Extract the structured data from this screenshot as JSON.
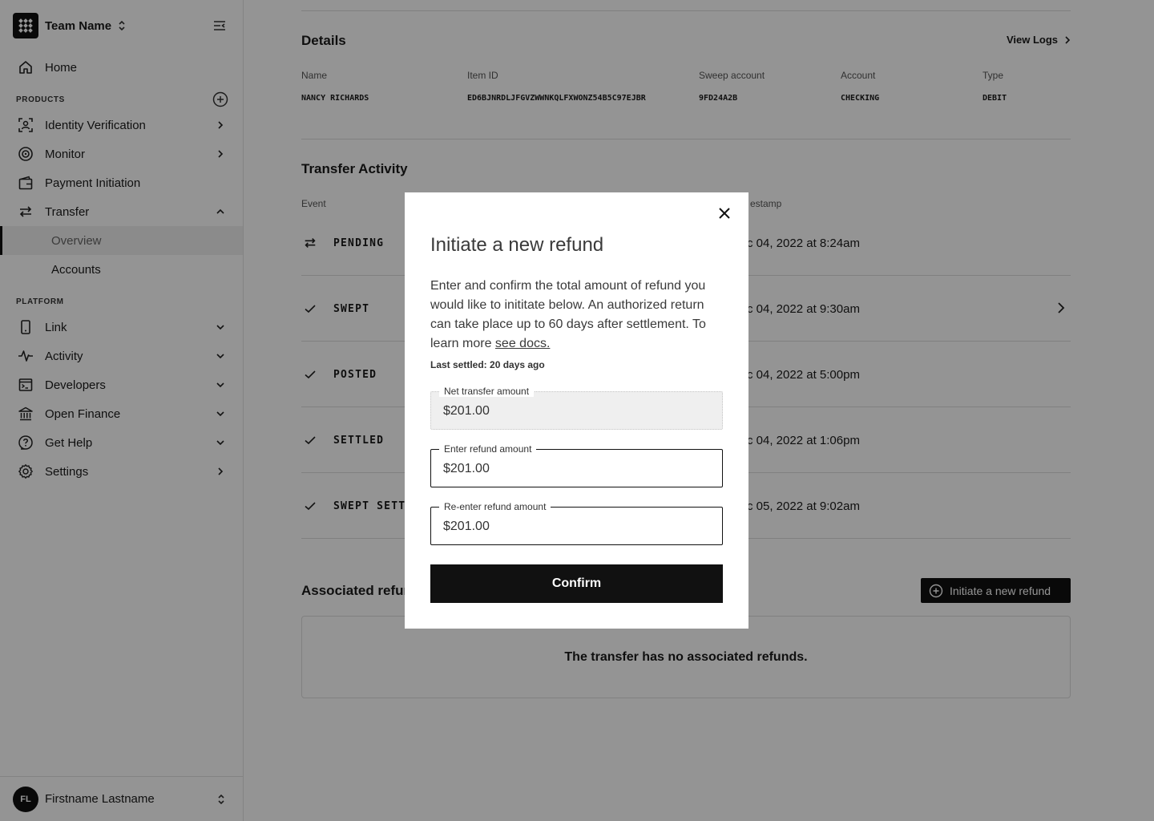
{
  "sidebar": {
    "team_name": "Team Name",
    "products_label": "PRODUCTS",
    "platform_label": "PLATFORM",
    "home": "Home",
    "products": [
      {
        "label": "Identity Verification"
      },
      {
        "label": "Monitor"
      },
      {
        "label": "Payment Initiation"
      },
      {
        "label": "Transfer"
      }
    ],
    "transfer_sub": [
      {
        "label": "Overview"
      },
      {
        "label": "Accounts"
      }
    ],
    "platform": [
      {
        "label": "Link"
      },
      {
        "label": "Activity"
      },
      {
        "label": "Developers"
      },
      {
        "label": "Open Finance"
      },
      {
        "label": "Get Help"
      },
      {
        "label": "Settings"
      }
    ],
    "user": {
      "initials": "FL",
      "name": "Firstname Lastname"
    }
  },
  "details": {
    "title": "Details",
    "view_logs": "View Logs",
    "columns": [
      {
        "header": "Name",
        "value": "NANCY RICHARDS"
      },
      {
        "header": "Item ID",
        "value": "ED6BJNRDLJFGVZWWNKQLFXWONZ54B5C97EJBR"
      },
      {
        "header": "Sweep account",
        "value": "9FD24A2B"
      },
      {
        "header": "Account",
        "value": "CHECKING"
      },
      {
        "header": "Type",
        "value": "DEBIT"
      }
    ]
  },
  "activity": {
    "title": "Transfer Activity",
    "event_header": "Event",
    "timestamp_header": "estamp",
    "events": [
      {
        "name": "PENDING",
        "timestamp": "c 04, 2022 at 8:24am"
      },
      {
        "name": "SWEPT",
        "timestamp": "c 04, 2022 at 9:30am"
      },
      {
        "name": "POSTED",
        "timestamp": "c 04, 2022 at 5:00pm"
      },
      {
        "name": "SETTLED",
        "timestamp": "c 04, 2022 at 1:06pm"
      },
      {
        "name": "SWEPT SETTL",
        "timestamp": "c 05, 2022 at 9:02am"
      }
    ]
  },
  "refunds": {
    "title": "Associated refun",
    "button": "Initiate a new refund",
    "empty": "The transfer has no associated refunds."
  },
  "modal": {
    "title": "Initiate a new refund",
    "description": "Enter and confirm the total amount of refund you would like to inititate below. An authorized return can take place up to 60 days after settlement. To learn more ",
    "link": "see docs.",
    "last_settled": "Last settled: 20 days ago",
    "net_label": "Net transfer amount",
    "net_value": "$201.00",
    "refund_label": "Enter refund amount",
    "refund_value": "$201.00",
    "reenter_label": "Re-enter refund amount",
    "reenter_value": "$201.00",
    "confirm": "Confirm"
  }
}
